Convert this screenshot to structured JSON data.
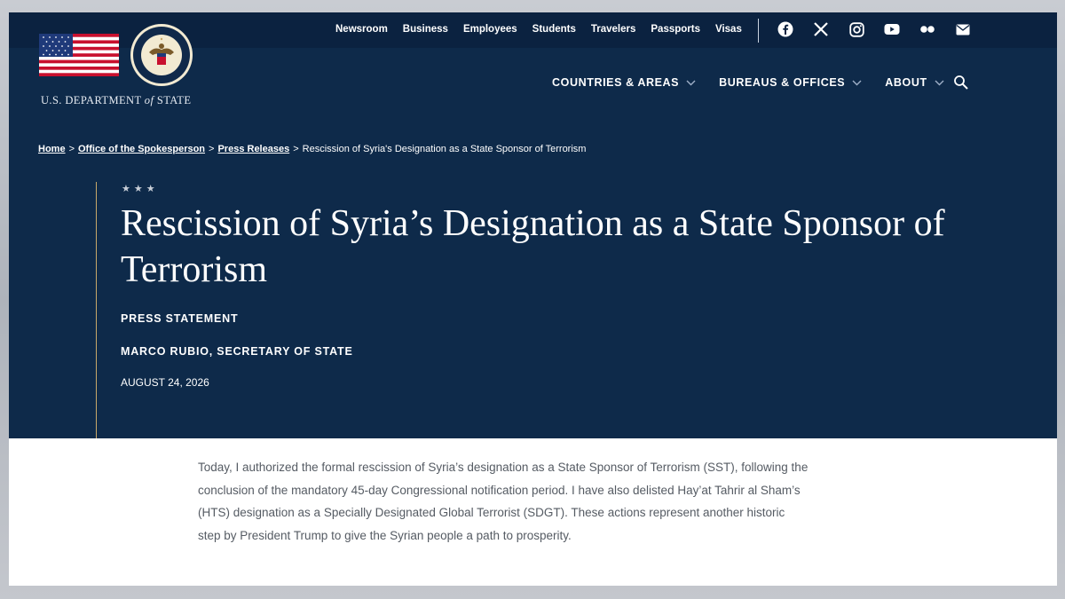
{
  "header": {
    "department_name_prefix": "U.S. DEPARTMENT",
    "department_name_of": "of",
    "department_name_suffix": "STATE",
    "utility_nav": [
      "Newsroom",
      "Business",
      "Employees",
      "Students",
      "Travelers",
      "Passports",
      "Visas"
    ],
    "social_icons": [
      "facebook-icon",
      "x-icon",
      "instagram-icon",
      "youtube-icon",
      "flickr-icon",
      "email-icon"
    ],
    "main_nav": [
      "COUNTRIES & AREAS",
      "BUREAUS & OFFICES",
      "ABOUT"
    ]
  },
  "breadcrumb": {
    "home": "Home",
    "spokesperson": "Office of the Spokesperson",
    "press_releases": "Press Releases",
    "current": "Rescission of Syria's Designation as a State Sponsor of Terrorism",
    "separator": ">"
  },
  "article": {
    "stars": "★★★",
    "title": "Rescission of Syria’s Designation as a State Sponsor of Terrorism",
    "type": "PRESS STATEMENT",
    "author": "MARCO RUBIO, SECRETARY OF STATE",
    "date": "AUGUST 24, 2026",
    "body": "Today, I authorized the formal rescission of Syria’s designation as a State Sponsor of Terrorism (SST), following the conclusion of the mandatory 45-day Congressional notification period.   I have also delisted Hay’at Tahrir al Sham’s (HTS) designation as a Specially Designated Global Terrorist (SDGT). These actions represent another historic step by President Trump to give the Syrian people a path to prosperity."
  },
  "colors": {
    "hero_background": "#0e2a4a",
    "top_bar": "#0b2240",
    "accent_line": "#c9a96a",
    "body_text": "#555b63"
  }
}
